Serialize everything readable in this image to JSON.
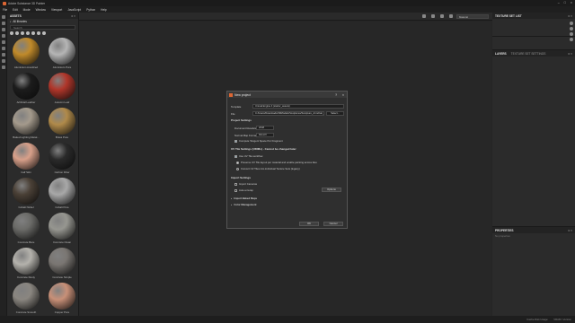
{
  "app": {
    "title": "Adobe Substance 3D Painter"
  },
  "menu": [
    "File",
    "Edit",
    "Mode",
    "Window",
    "Viewport",
    "JavaScript",
    "Python",
    "Help"
  ],
  "toolbar": {
    "camera_select": "Material"
  },
  "assets": {
    "title": "ASSETS",
    "all_label": "All libraries",
    "search_placeholder": "Search",
    "items": [
      {
        "label": "Aluminium Anodized",
        "color": "#c08a2a"
      },
      {
        "label": "Aluminium Pure",
        "color": "#b5b5b5"
      },
      {
        "label": "Artificial Leather",
        "color": "#1c1c1c"
      },
      {
        "label": "Autumn Leaf",
        "color": "#b0362a"
      },
      {
        "label": "Baked Lighting Metal...",
        "color": "#a49a8c"
      },
      {
        "label": "Brass Pure",
        "color": "#b08a4a"
      },
      {
        "label": "Calf Skin",
        "color": "#d8a08a"
      },
      {
        "label": "Carbon Fiber",
        "color": "#2a2a2a"
      },
      {
        "label": "Cobalt Nickel",
        "color": "#4a4036"
      },
      {
        "label": "Cobalt Pure",
        "color": "#a8a8a8"
      },
      {
        "label": "Concrete Bare",
        "color": "#6b6b68"
      },
      {
        "label": "Concrete Clean",
        "color": "#969690"
      },
      {
        "label": "Concrete Dusty",
        "color": "#b4b2ac"
      },
      {
        "label": "Concrete Simple",
        "color": "#7a7672"
      },
      {
        "label": "Concrete Smooth",
        "color": "#8a8680"
      },
      {
        "label": "Copper Pure",
        "color": "#c89078"
      }
    ]
  },
  "right_panel": {
    "texture_set_list_title": "TEXTURE SET LIST",
    "layers_title": "LAYERS",
    "texture_set_settings_title": "TEXTURE SET SETTINGS",
    "properties_title": "PROPERTIES",
    "properties_sub": "No properties"
  },
  "status": {
    "cache": "Cache Disk Usage:",
    "version": "VRAM / Version"
  },
  "dialog": {
    "title": "New project",
    "help": "?",
    "close": "×",
    "template_label": "Template",
    "template_value": "Unreal Engine 4 (starter_assets)",
    "file_label": "File",
    "file_value": "C:/Users/Downloads/3DModels/Sculptures/Sculpture_Armchair_low.fbx",
    "select_button": "Select...",
    "project_settings_title": "Project Settings",
    "doc_res_label": "Document Resolution",
    "doc_res_value": "2048",
    "normal_map_label": "Normal Map Format",
    "normal_map_value": "DirectX",
    "compute_tangent_label": "Compute Tangent Space Per Fragment",
    "uv_title": "UV Tile Settings (UDIMs) - Cannot be changed later",
    "use_uv_tile_label": "Use UV Tile workflow",
    "opt1_label": "Preserve UV Tile layout per material and enable painting across tiles",
    "opt2_label": "Convert UV Tiles into individual Texture Sets (legacy)",
    "import_settings_title": "Import Settings",
    "import_cameras_label": "Import Cameras",
    "auto_unwrap_label": "Auto-unwrap",
    "options_button": "Options",
    "baked_maps_label": "Import Baked Maps",
    "color_mgmt_label": "Color Management",
    "ok_button": "OK",
    "cancel_button": "Cancel"
  }
}
